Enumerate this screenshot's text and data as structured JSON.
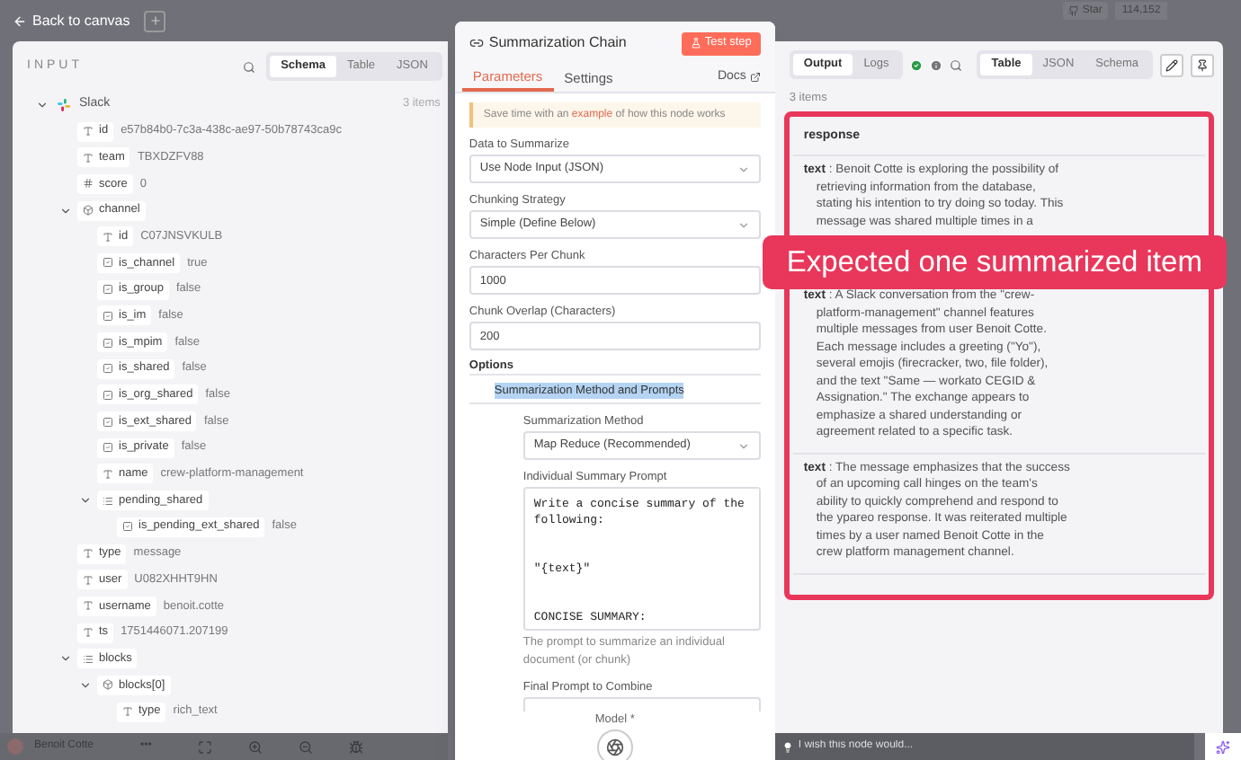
{
  "top_bar": {
    "back_label": "Back to canvas",
    "star_label": "Star",
    "star_count": "114,152"
  },
  "input_panel": {
    "title": "INPUT",
    "view_tabs": [
      {
        "label": "Schema",
        "selected": true
      },
      {
        "label": "Table",
        "selected": false
      },
      {
        "label": "JSON",
        "selected": false
      }
    ],
    "source": {
      "name": "Slack",
      "count": "3 items",
      "expanded": true
    },
    "fields": [
      {
        "kind": "string",
        "key": "id",
        "value": "e57b84b0-7c3a-438c-ae97-50b78743ca9c"
      },
      {
        "kind": "string",
        "key": "team",
        "value": "TBXDZFV88"
      },
      {
        "kind": "number",
        "key": "score",
        "value": "0"
      },
      {
        "kind": "object",
        "key": "channel",
        "expanded": true,
        "children": [
          {
            "kind": "string",
            "key": "id",
            "value": "C07JNSVKULB"
          },
          {
            "kind": "boolean",
            "key": "is_channel",
            "value": "true"
          },
          {
            "kind": "boolean",
            "key": "is_group",
            "value": "false"
          },
          {
            "kind": "boolean",
            "key": "is_im",
            "value": "false"
          },
          {
            "kind": "boolean",
            "key": "is_mpim",
            "value": "false"
          },
          {
            "kind": "boolean",
            "key": "is_shared",
            "value": "false"
          },
          {
            "kind": "boolean",
            "key": "is_org_shared",
            "value": "false"
          },
          {
            "kind": "boolean",
            "key": "is_ext_shared",
            "value": "false"
          },
          {
            "kind": "boolean",
            "key": "is_private",
            "value": "false"
          },
          {
            "kind": "string",
            "key": "name",
            "value": "crew-platform-management"
          },
          {
            "kind": "array",
            "key": "pending_shared",
            "expanded": true,
            "children": [
              {
                "kind": "boolean",
                "key": "is_pending_ext_shared",
                "value": "false"
              }
            ]
          }
        ]
      },
      {
        "kind": "string",
        "key": "type",
        "value": "message"
      },
      {
        "kind": "string",
        "key": "user",
        "value": "U082XHHT9HN"
      },
      {
        "kind": "string",
        "key": "username",
        "value": "benoit.cotte"
      },
      {
        "kind": "string",
        "key": "ts",
        "value": "1751446071.207199"
      },
      {
        "kind": "array",
        "key": "blocks",
        "expanded": true,
        "children": [
          {
            "kind": "object",
            "key": "blocks[0]",
            "expanded": true,
            "children": [
              {
                "kind": "string",
                "key": "type",
                "value": "rich_text"
              }
            ]
          }
        ]
      }
    ]
  },
  "node_panel": {
    "title": "Summarization Chain",
    "test_button": "Test step",
    "tabs": [
      {
        "label": "Parameters",
        "selected": true
      },
      {
        "label": "Settings",
        "selected": false
      }
    ],
    "docs_link": "Docs",
    "notice": {
      "before": "Save time with an ",
      "link": "example",
      "after": " of how this node works"
    },
    "parameters": [
      {
        "kind": "select",
        "label": "Data to Summarize",
        "value": "Use Node Input (JSON)"
      },
      {
        "kind": "select",
        "label": "Chunking Strategy",
        "value": "Simple (Define Below)"
      },
      {
        "kind": "input",
        "label": "Characters Per Chunk",
        "value": "1000"
      },
      {
        "kind": "input",
        "label": "Chunk Overlap (Characters)",
        "value": "200"
      }
    ],
    "options_label": "Options",
    "collection": {
      "label": "Summarization Method and Prompts",
      "text_selected": true
    },
    "options": [
      {
        "kind": "select",
        "label": "Summarization Method",
        "value": "Map Reduce (Recommended)"
      },
      {
        "kind": "textarea",
        "label": "Individual Summary Prompt",
        "value": "Write a concise summary of the following:\n\n\n\"{text}\"\n\n\nCONCISE SUMMARY:",
        "hint": "The prompt to summarize an individual document (or chunk)"
      },
      {
        "kind": "cut",
        "label": "Final Prompt to Combine"
      }
    ],
    "footer_label": "Model *"
  },
  "output_panel": {
    "mode_tabs": [
      {
        "label": "Output",
        "selected": true
      },
      {
        "label": "Logs",
        "selected": false
      }
    ],
    "view_tabs": [
      {
        "label": "Table",
        "selected": true
      },
      {
        "label": "JSON",
        "selected": false
      },
      {
        "label": "Schema",
        "selected": false
      }
    ],
    "count": "3 items",
    "column": "response",
    "rows": [
      {
        "key": "text",
        "value": ": Benoit Cotte is exploring the possibility of retrieving information from the database, stating his intention to try doing so today. This message was shared multiple times in a"
      },
      {
        "key": "text",
        "value": ": A Slack conversation from the \"crew-platform-management\" channel features multiple messages from user Benoit Cotte. Each message includes a greeting (\"Yo\"), several emojis (firecracker, two, file folder), and the text \"Same — workato CEGID & Assignation.\" The exchange appears to emphasize a shared understanding or agreement related to a specific task."
      },
      {
        "key": "text",
        "value": ": The message emphasizes that the success of an upcoming call hinges on the team's ability to quickly comprehend and respond to the ypareo response. It was reiterated multiple times by a user named Benoit Cotte in the crew platform management channel."
      }
    ]
  },
  "callout": "Expected one summarized item",
  "bottom_bar": {
    "user": "Benoit Cotte",
    "more": "•••",
    "ask_placeholder": "I wish this node would..."
  }
}
